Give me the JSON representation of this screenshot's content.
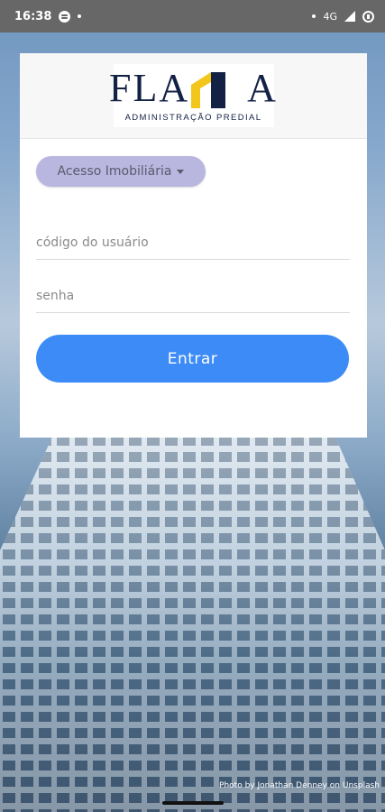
{
  "status_bar": {
    "time": "16:38",
    "network": "4G"
  },
  "logo": {
    "wordmark_left": "FLA",
    "wordmark_right": "A",
    "subtitle": "ADMINISTRAÇÃO PREDIAL"
  },
  "login": {
    "access_dropdown": "Acesso Imobiliária",
    "user_placeholder": "código do usuário",
    "password_placeholder": "senha",
    "submit_label": "Entrar"
  },
  "photo_credit": {
    "prefix": "Photo by",
    "author": "Jonathan Denney",
    "middle": "on",
    "site": "Unsplash"
  },
  "colors": {
    "primary_button": "#3d8bf7",
    "dropdown_bg": "#b9b7e0",
    "logo_navy": "#132145",
    "logo_yellow": "#f3c61b"
  }
}
